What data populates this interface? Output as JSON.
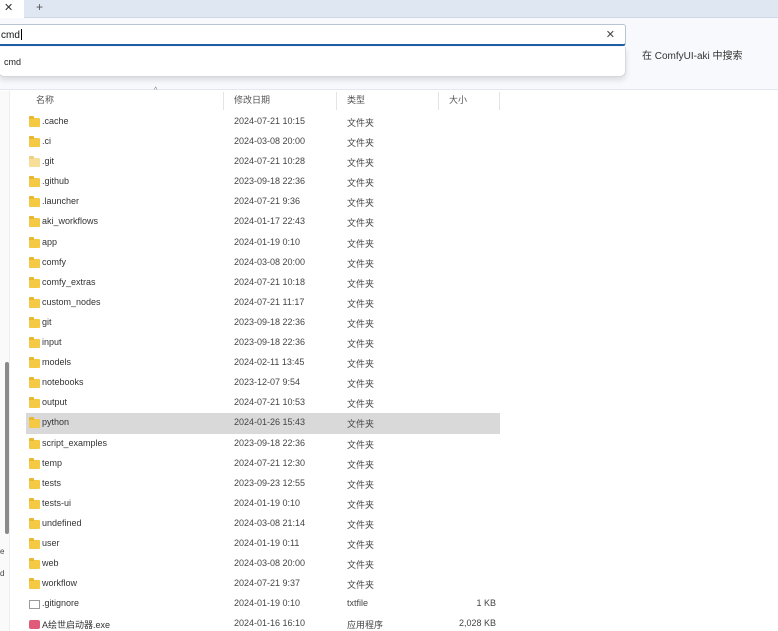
{
  "tabbar": {
    "close_icon": "✕",
    "new_tab_icon": "+"
  },
  "address": {
    "value": "cmd",
    "clear_icon": "✕"
  },
  "search": {
    "placeholder": "在 ComfyUI-aki 中搜索"
  },
  "suggestion": {
    "label": "cmd"
  },
  "columns": {
    "name": "名称",
    "date": "修改日期",
    "type": "类型",
    "size": "大小"
  },
  "left_marks": [
    "e",
    "d"
  ],
  "files": [
    {
      "name": ".cache",
      "date": "2024-07-21 10:15",
      "type": "文件夹",
      "size": "",
      "icon": "folder"
    },
    {
      "name": ".ci",
      "date": "2024-03-08 20:00",
      "type": "文件夹",
      "size": "",
      "icon": "folder"
    },
    {
      "name": ".git",
      "date": "2024-07-21 10:28",
      "type": "文件夹",
      "size": "",
      "icon": "folder-light"
    },
    {
      "name": ".github",
      "date": "2023-09-18 22:36",
      "type": "文件夹",
      "size": "",
      "icon": "folder"
    },
    {
      "name": ".launcher",
      "date": "2024-07-21 9:36",
      "type": "文件夹",
      "size": "",
      "icon": "folder"
    },
    {
      "name": "aki_workflows",
      "date": "2024-01-17 22:43",
      "type": "文件夹",
      "size": "",
      "icon": "folder"
    },
    {
      "name": "app",
      "date": "2024-01-19 0:10",
      "type": "文件夹",
      "size": "",
      "icon": "folder"
    },
    {
      "name": "comfy",
      "date": "2024-03-08 20:00",
      "type": "文件夹",
      "size": "",
      "icon": "folder"
    },
    {
      "name": "comfy_extras",
      "date": "2024-07-21 10:18",
      "type": "文件夹",
      "size": "",
      "icon": "folder"
    },
    {
      "name": "custom_nodes",
      "date": "2024-07-21 11:17",
      "type": "文件夹",
      "size": "",
      "icon": "folder"
    },
    {
      "name": "git",
      "date": "2023-09-18 22:36",
      "type": "文件夹",
      "size": "",
      "icon": "folder"
    },
    {
      "name": "input",
      "date": "2023-09-18 22:36",
      "type": "文件夹",
      "size": "",
      "icon": "folder"
    },
    {
      "name": "models",
      "date": "2024-02-11 13:45",
      "type": "文件夹",
      "size": "",
      "icon": "folder"
    },
    {
      "name": "notebooks",
      "date": "2023-12-07 9:54",
      "type": "文件夹",
      "size": "",
      "icon": "folder"
    },
    {
      "name": "output",
      "date": "2024-07-21 10:53",
      "type": "文件夹",
      "size": "",
      "icon": "folder"
    },
    {
      "name": "python",
      "date": "2024-01-26 15:43",
      "type": "文件夹",
      "size": "",
      "icon": "folder",
      "selected": true
    },
    {
      "name": "script_examples",
      "date": "2023-09-18 22:36",
      "type": "文件夹",
      "size": "",
      "icon": "folder"
    },
    {
      "name": "temp",
      "date": "2024-07-21 12:30",
      "type": "文件夹",
      "size": "",
      "icon": "folder"
    },
    {
      "name": "tests",
      "date": "2023-09-23 12:55",
      "type": "文件夹",
      "size": "",
      "icon": "folder"
    },
    {
      "name": "tests-ui",
      "date": "2024-01-19 0:10",
      "type": "文件夹",
      "size": "",
      "icon": "folder"
    },
    {
      "name": "undefined",
      "date": "2024-03-08 21:14",
      "type": "文件夹",
      "size": "",
      "icon": "folder"
    },
    {
      "name": "user",
      "date": "2024-01-19 0:11",
      "type": "文件夹",
      "size": "",
      "icon": "folder"
    },
    {
      "name": "web",
      "date": "2024-03-08 20:00",
      "type": "文件夹",
      "size": "",
      "icon": "folder"
    },
    {
      "name": "workflow",
      "date": "2024-07-21 9:37",
      "type": "文件夹",
      "size": "",
      "icon": "folder"
    },
    {
      "name": ".gitignore",
      "date": "2024-01-19 0:10",
      "type": "txtfile",
      "size": "1 KB",
      "icon": "file"
    },
    {
      "name": "A绘世启动器.exe",
      "date": "2024-01-16 16:10",
      "type": "应用程序",
      "size": "2,028 KB",
      "icon": "exe"
    }
  ]
}
